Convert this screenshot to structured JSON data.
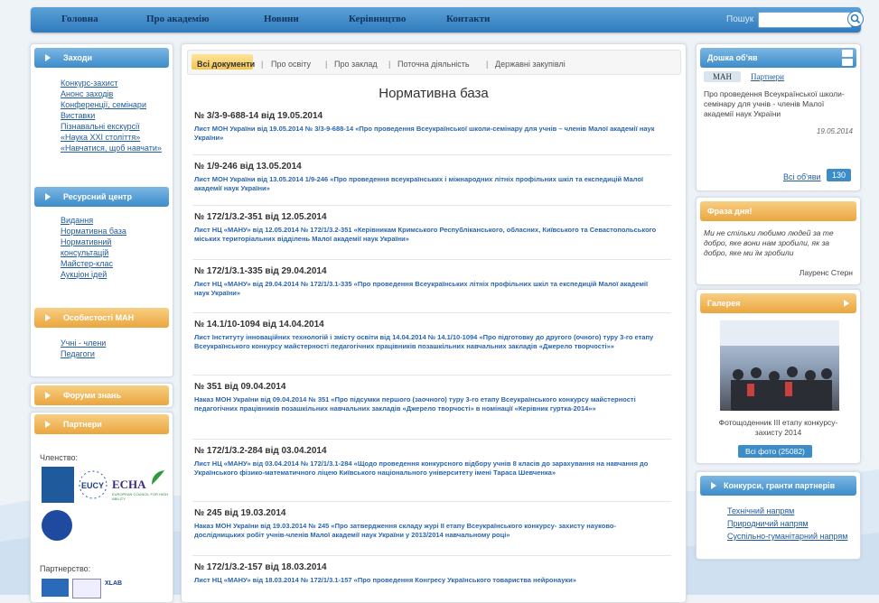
{
  "colors": {
    "nav": "#2f7bbd",
    "blue_bar": "#3c8cca",
    "orange_bar": "#eaa53e",
    "link": "#1f5b9c",
    "doc_link": "#2a66b0"
  },
  "nav": {
    "items": [
      "Головна",
      "Про академію",
      "Новини",
      "Керівництво",
      "Контакти"
    ],
    "search_label": "Пошук",
    "search_value": ""
  },
  "left": {
    "events": {
      "title": "Заходи",
      "links": [
        "Конкурс-захист",
        "Анонс заходів",
        "Конференції, семінари",
        "Виставки",
        "Пізнавальні екскурсії",
        "«Наука XXI століття»",
        "«Навчатися, щоб навчати»"
      ]
    },
    "resources": {
      "title": "Ресурсний центр",
      "links": [
        "Видання",
        "Нормативна база",
        "Нормативний",
        "консультацій",
        "Майстер-клас",
        "Аукціон ідей"
      ]
    },
    "features": {
      "title": "Особистості МАН",
      "links": [
        "Учні - члени",
        "Педагоги"
      ]
    },
    "forum": {
      "title": "Форуми знань"
    },
    "partners": {
      "title": "Партнери",
      "membership_label": "Членство:",
      "partnership_label": "Партнерство:",
      "logo_text": "ECHA",
      "logo_sub": "EUROPEAN COUNCIL FOR HIGH ABILITY",
      "xlab_text": "XLAB"
    }
  },
  "main": {
    "tabs": [
      "Всі документи",
      "Про освіту",
      "Про заклад",
      "Поточна діяльність",
      "Державні закупівлі"
    ],
    "page_title": "Нормативна база",
    "documents": [
      {
        "title": "№ 3/3-9-688-14 від 19.05.2014",
        "desc": "Лист МОН України від 19.05.2014 № 3/3-9-688-14 «Про проведення Всеукраїнської школи-семінару для учнів – членів Малої академії наук України»"
      },
      {
        "title": "№ 1/9-246 від 13.05.2014",
        "desc": "Лист МОН України від 13.05.2014 1/9-246 «Про проведення всеукраїнських і міжнародних літніх профільних шкіл та експедицій Малої академії наук України»"
      },
      {
        "title": "№ 172/1/3.2-351 від 12.05.2014",
        "desc": "Лист НЦ «МАНУ» від 12.05.2014 № 172/1/3.2-351 «Керівникам Кримського Республіканського, обласних, Київського та Севастопольського міських територіальних відділень Малої академії наук України»"
      },
      {
        "title": "№ 172/1/3.1-335 від 29.04.2014",
        "desc": "Лист НЦ «МАНУ» від 29.04.2014 № 172/1/3.1-335 «Про проведення Всеукраїнських літніх профільних шкіл та експедицій Малої академії наук України»"
      },
      {
        "title": "№ 14.1/10-1094 від 14.04.2014",
        "desc": "Лист Інституту інноваційних технологій і змісту освіти від 14.04.2014 № 14.1/10-1094 «Про підготовку до другого (очного) туру 3-го етапу Всеукраїнського конкурсу майстерності педагогічних працівників позашкільних навчальних закладів «Джерело творчості»»"
      },
      {
        "title": "№ 351 від 09.04.2014",
        "desc": "Наказ МОН України від 09.04.2014 № 351 «Про підсумки першого (заочного) туру 3-го етапу Всеукраїнського конкурсу майстерності педагогічних працівників позашкільних навчальних закладів «Джерело творчості» в номінації «Керівник гуртка-2014»»"
      },
      {
        "title": "№ 172/1/3.2-284 від 03.04.2014",
        "desc": "Лист НЦ «МАНУ» від 03.04.2014 № 172/1/3.1-284 «Щодо проведення конкурсного відбору учнів 8 класів до зарахування на навчання до Українського фізико-математичного ліцею Київського національного університету імені Тараса Шевченка»"
      },
      {
        "title": "№ 245 від 19.03.2014",
        "desc": "Наказ МОН України від 19.03.2014 № 245 «Про затвердження складу журі ІІ етапу Всеукраїнського конкурсу- захисту науково-дослідницьких робіт учнів-членів Малої академії наук України у 2013/2014 навчальному році»"
      },
      {
        "title": "№ 172/1/3.2-157 від 18.03.2014",
        "desc": "Лист НЦ «МАНУ» від 18.03.2014 № 172/1/3.1-157 «Про проведення Конгресу Українського товариства нейронауки»"
      }
    ]
  },
  "right": {
    "board": {
      "title": "Дошка об'яв",
      "tabs": [
        "МАН",
        "Партнери"
      ],
      "text": "Про проведення Всеукраїнської школи-семінару для учнів - членів Малої академії наук України",
      "date": "19.05.2014",
      "all_label": "Всі об'яви",
      "count": "130"
    },
    "phrase": {
      "title": "Фраза дня!",
      "quote": "Ми не стільки любимо людей за те добро, яке вони нам зробили, як за добро, яке ми їм зробили",
      "author": "Лауренс Стерн"
    },
    "gallery": {
      "title": "Галерея",
      "caption": "Фотощоденник ІІІ етапу конкурсу-захисту 2014",
      "button": "Всі фото (25082)"
    },
    "contests": {
      "title": "Конкурси, гранти партнерів",
      "links": [
        "Технічний напрям",
        "Природничий напрям",
        "Суспільно-гуманітарний напрям"
      ]
    }
  }
}
